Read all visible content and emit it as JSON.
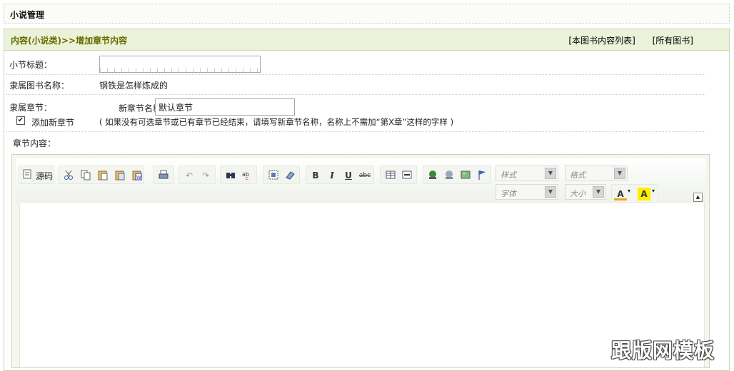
{
  "page": {
    "title": "小说管理"
  },
  "panel": {
    "breadcrumb": "内容(小说类)>>增加章节内容",
    "links": [
      "[本图书内容列表]",
      "[所有图书]"
    ]
  },
  "form": {
    "section_title_label": "小节标题：",
    "section_title_value": "",
    "book_name_label": "隶属图书名称：",
    "book_name_value": "钢铁是怎样炼成的",
    "chapter_label": "隶属章节：",
    "new_chapter_label": "新章节名称：",
    "new_chapter_value": "默认章节",
    "add_chapter_checkbox": {
      "label": "添加新章节",
      "checked": true
    },
    "hint": "( 如果没有可选章节或已有章节已经结束，请填写新章节名称，名称上不需加“第X章”这样的字样 )",
    "content_label": "章节内容："
  },
  "editor": {
    "source_button": "源码",
    "combos": {
      "style": "样式",
      "format": "格式",
      "font": "字体",
      "size": "大小"
    },
    "tool_glyphs": {
      "bold": "B",
      "italic": "I",
      "underline": "U",
      "strike": "abc",
      "text_color": "A",
      "bg_color": "A"
    }
  },
  "watermark": "跟版网模板"
}
